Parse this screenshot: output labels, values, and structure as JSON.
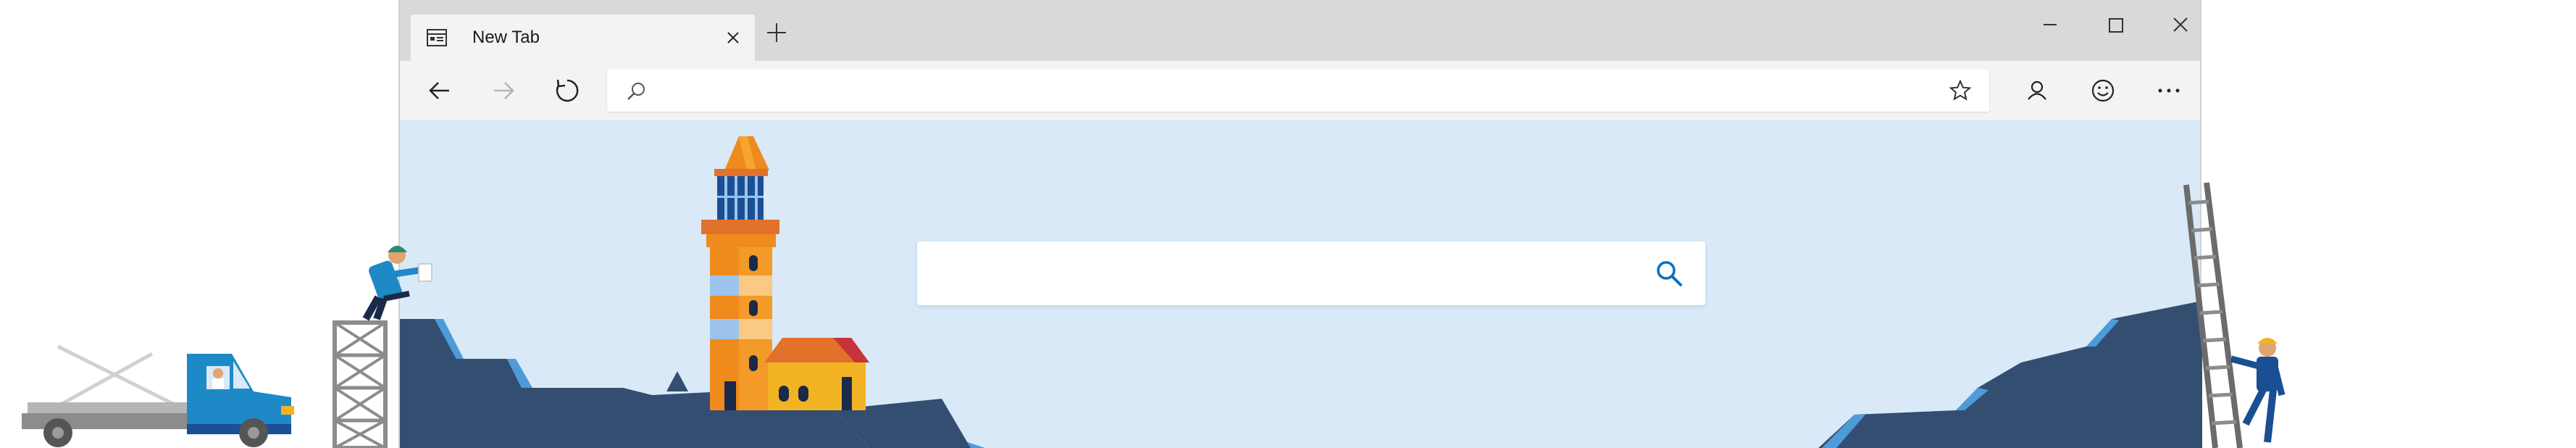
{
  "tab": {
    "title": "New Tab"
  },
  "address_bar": {
    "value": "",
    "placeholder": ""
  },
  "search": {
    "value": "",
    "placeholder": ""
  },
  "colors": {
    "page_background": "#d9e9f7",
    "accent": "#0a6fc2",
    "titlebar": "#d9d9d9",
    "toolbar": "#f3f3f3"
  },
  "icons": {
    "tab": "page-icon",
    "close_tab": "close-icon",
    "new_tab": "plus-icon",
    "minimize": "minimize-icon",
    "maximize": "maximize-icon",
    "close_window": "close-icon",
    "back": "back-arrow-icon",
    "forward": "forward-arrow-icon",
    "refresh": "refresh-icon",
    "address_search": "search-icon",
    "favorite": "star-icon",
    "profile": "profile-icon",
    "feedback": "smiley-icon",
    "more": "more-icon",
    "search_submit": "search-icon"
  }
}
